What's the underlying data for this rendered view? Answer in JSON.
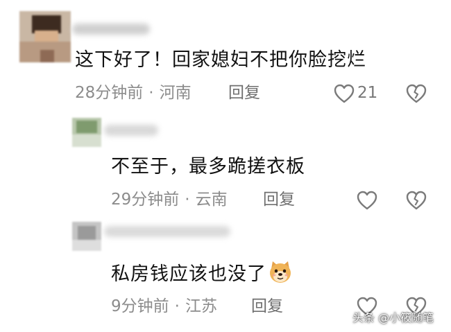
{
  "comments": [
    {
      "text": "这下好了！回家媳妇不把你脸挖烂",
      "time": "28分钟前",
      "location": "河南",
      "reply_label": "回复",
      "likes": "21"
    },
    {
      "text": "不至于，最多跪搓衣板",
      "time": "29分钟前",
      "location": "云南",
      "reply_label": "回复",
      "likes": ""
    },
    {
      "text": "私房钱应该也没了",
      "time": "9分钟前",
      "location": "江苏",
      "reply_label": "回复",
      "likes": ""
    }
  ],
  "separator": "·",
  "watermark": "头条 @小筱随笔",
  "icons": {
    "like": "heart-outline-icon",
    "dislike": "broken-heart-icon",
    "emoji": "doge-emoji"
  },
  "colors": {
    "text": "#111111",
    "meta": "#8c8c8c",
    "icon": "#7a7a7a"
  }
}
